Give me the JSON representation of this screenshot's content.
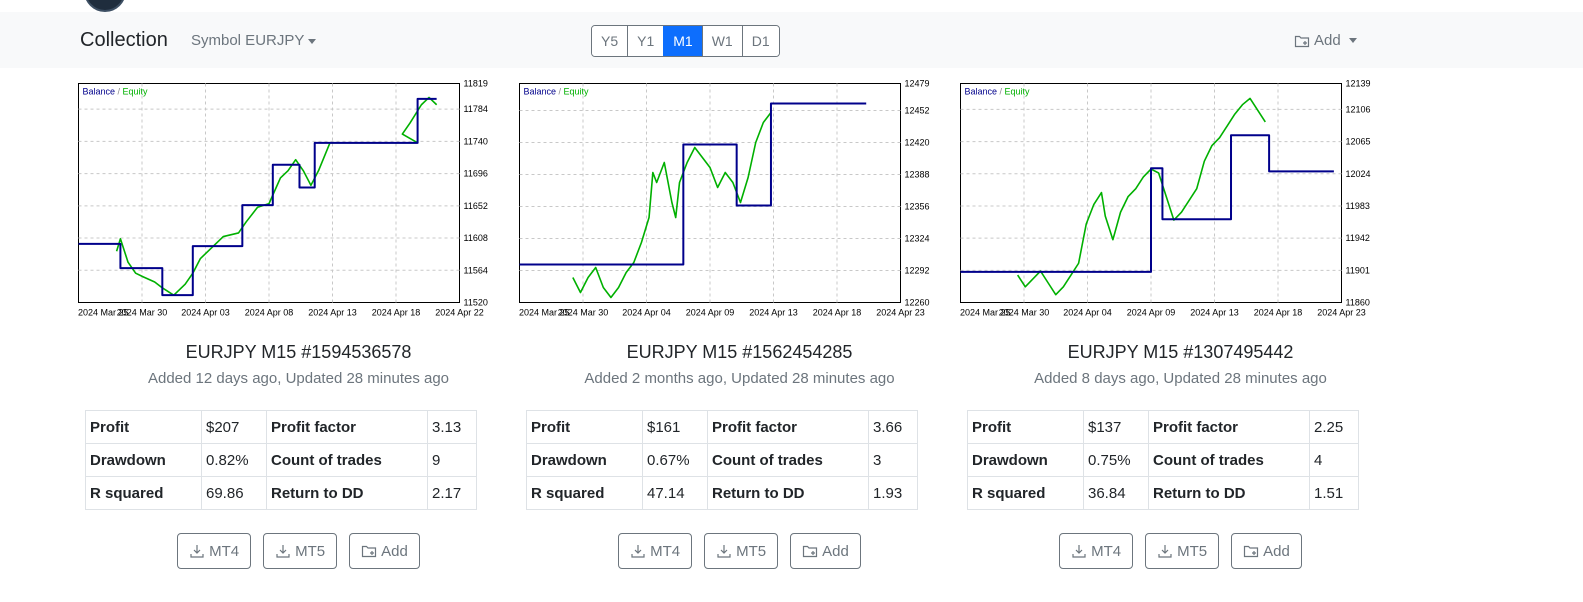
{
  "navbar": {
    "brand": "Collection",
    "symbol_label": "Symbol EURJPY",
    "timeframes": [
      "Y5",
      "Y1",
      "M1",
      "W1",
      "D1"
    ],
    "active_timeframe": "M1",
    "add_label": "Add"
  },
  "colors": {
    "balance": "#00008b",
    "equity": "#00b000",
    "accent": "#0d6efd",
    "muted": "#6c757d"
  },
  "stat_labels": {
    "profit": "Profit",
    "profit_factor": "Profit factor",
    "drawdown": "Drawdown",
    "count_of_trades": "Count of trades",
    "r_squared": "R squared",
    "return_to_dd": "Return to DD"
  },
  "button_labels": {
    "mt4": "MT4",
    "mt5": "MT5",
    "add": "Add"
  },
  "cards": [
    {
      "title": "EURJPY M15 #1594536578",
      "subtitle": "Added 12 days ago, Updated 28 minutes ago",
      "stats": {
        "profit": "$207",
        "profit_factor": "3.13",
        "drawdown": "0.82%",
        "count_of_trades": "9",
        "r_squared": "69.86",
        "return_to_dd": "2.17"
      },
      "chart_data": {
        "type": "line",
        "legend": [
          "Balance",
          "Equity"
        ],
        "x_ticks": [
          "2024 Mar 25",
          "2024 Mar 30",
          "2024 Apr 03",
          "2024 Apr 08",
          "2024 Apr 13",
          "2024 Apr 18",
          "2024 Apr 22"
        ],
        "y_ticks": [
          11520,
          11564,
          11608,
          11652,
          11696,
          11740,
          11784,
          11819
        ],
        "ylim": [
          11520,
          11819
        ],
        "grid": true,
        "balance": [
          [
            0,
            11600
          ],
          [
            0.11,
            11600
          ],
          [
            0.11,
            11567
          ],
          [
            0.22,
            11567
          ],
          [
            0.22,
            11530
          ],
          [
            0.3,
            11530
          ],
          [
            0.3,
            11597
          ],
          [
            0.43,
            11597
          ],
          [
            0.43,
            11653
          ],
          [
            0.51,
            11653
          ],
          [
            0.51,
            11708
          ],
          [
            0.58,
            11708
          ],
          [
            0.58,
            11677
          ],
          [
            0.62,
            11677
          ],
          [
            0.62,
            11738
          ],
          [
            0.89,
            11738
          ],
          [
            0.89,
            11798
          ],
          [
            0.94,
            11798
          ]
        ],
        "equity": [
          [
            0.1,
            11590
          ],
          [
            0.11,
            11607
          ],
          [
            0.13,
            11575
          ],
          [
            0.15,
            11560
          ],
          [
            0.17,
            11555
          ],
          [
            0.2,
            11548
          ],
          [
            0.22,
            11540
          ],
          [
            0.25,
            11530
          ],
          [
            0.28,
            11545
          ],
          [
            0.3,
            11560
          ],
          [
            0.32,
            11580
          ],
          [
            0.35,
            11595
          ],
          [
            0.38,
            11610
          ],
          [
            0.42,
            11615
          ],
          [
            0.44,
            11630
          ],
          [
            0.47,
            11650
          ],
          [
            0.5,
            11655
          ],
          [
            0.53,
            11690
          ],
          [
            0.55,
            11700
          ],
          [
            0.57,
            11715
          ],
          [
            0.59,
            11700
          ],
          [
            0.61,
            11680
          ],
          [
            0.63,
            11700
          ],
          [
            0.66,
            11738
          ],
          [
            0.89,
            11738
          ],
          [
            0.85,
            11750
          ],
          [
            0.87,
            11765
          ],
          [
            0.9,
            11790
          ],
          [
            0.92,
            11800
          ],
          [
            0.94,
            11790
          ]
        ]
      }
    },
    {
      "title": "EURJPY M15 #1562454285",
      "subtitle": "Added 2 months ago, Updated 28 minutes ago",
      "stats": {
        "profit": "$161",
        "profit_factor": "3.66",
        "drawdown": "0.67%",
        "count_of_trades": "3",
        "r_squared": "47.14",
        "return_to_dd": "1.93"
      },
      "chart_data": {
        "type": "line",
        "legend": [
          "Balance",
          "Equity"
        ],
        "x_ticks": [
          "2024 Mar 25",
          "2024 Mar 30",
          "2024 Apr 04",
          "2024 Apr 09",
          "2024 Apr 13",
          "2024 Apr 18",
          "2024 Apr 23"
        ],
        "y_ticks": [
          12260,
          12292,
          12324,
          12356,
          12388,
          12420,
          12452,
          12479
        ],
        "ylim": [
          12260,
          12479
        ],
        "grid": true,
        "balance": [
          [
            0,
            12298
          ],
          [
            0.43,
            12298
          ],
          [
            0.43,
            12418
          ],
          [
            0.57,
            12418
          ],
          [
            0.57,
            12357
          ],
          [
            0.66,
            12357
          ],
          [
            0.66,
            12459
          ],
          [
            0.91,
            12459
          ]
        ],
        "equity": [
          [
            0.14,
            12285
          ],
          [
            0.16,
            12270
          ],
          [
            0.18,
            12285
          ],
          [
            0.2,
            12295
          ],
          [
            0.22,
            12275
          ],
          [
            0.24,
            12265
          ],
          [
            0.26,
            12275
          ],
          [
            0.28,
            12290
          ],
          [
            0.3,
            12300
          ],
          [
            0.32,
            12320
          ],
          [
            0.34,
            12345
          ],
          [
            0.35,
            12390
          ],
          [
            0.36,
            12380
          ],
          [
            0.38,
            12400
          ],
          [
            0.4,
            12360
          ],
          [
            0.41,
            12345
          ],
          [
            0.42,
            12380
          ],
          [
            0.44,
            12400
          ],
          [
            0.46,
            12415
          ],
          [
            0.48,
            12405
          ],
          [
            0.5,
            12395
          ],
          [
            0.52,
            12375
          ],
          [
            0.54,
            12390
          ],
          [
            0.56,
            12380
          ],
          [
            0.58,
            12360
          ],
          [
            0.6,
            12385
          ],
          [
            0.62,
            12420
          ],
          [
            0.64,
            12440
          ],
          [
            0.66,
            12450
          ]
        ]
      }
    },
    {
      "title": "EURJPY M15 #1307495442",
      "subtitle": "Added 8 days ago, Updated 28 minutes ago",
      "stats": {
        "profit": "$137",
        "profit_factor": "2.25",
        "drawdown": "0.75%",
        "count_of_trades": "4",
        "r_squared": "36.84",
        "return_to_dd": "1.51"
      },
      "chart_data": {
        "type": "line",
        "legend": [
          "Balance",
          "Equity"
        ],
        "x_ticks": [
          "2024 Mar 25",
          "2024 Mar 30",
          "2024 Apr 04",
          "2024 Apr 09",
          "2024 Apr 13",
          "2024 Apr 18",
          "2024 Apr 23"
        ],
        "y_ticks": [
          11860,
          11901,
          11942,
          11983,
          12024,
          12065,
          12106,
          12139
        ],
        "ylim": [
          11860,
          12139
        ],
        "grid": true,
        "balance": [
          [
            0,
            11899
          ],
          [
            0.5,
            11899
          ],
          [
            0.5,
            12031
          ],
          [
            0.53,
            12031
          ],
          [
            0.53,
            11966
          ],
          [
            0.71,
            11966
          ],
          [
            0.71,
            12073
          ],
          [
            0.81,
            12073
          ],
          [
            0.81,
            12027
          ],
          [
            0.98,
            12027
          ]
        ],
        "equity": [
          [
            0.15,
            11895
          ],
          [
            0.17,
            11880
          ],
          [
            0.19,
            11890
          ],
          [
            0.21,
            11900
          ],
          [
            0.23,
            11885
          ],
          [
            0.25,
            11870
          ],
          [
            0.27,
            11880
          ],
          [
            0.29,
            11895
          ],
          [
            0.31,
            11910
          ],
          [
            0.33,
            11960
          ],
          [
            0.35,
            11985
          ],
          [
            0.37,
            12000
          ],
          [
            0.38,
            11970
          ],
          [
            0.4,
            11940
          ],
          [
            0.42,
            11975
          ],
          [
            0.44,
            11995
          ],
          [
            0.46,
            12005
          ],
          [
            0.48,
            12020
          ],
          [
            0.5,
            12030
          ],
          [
            0.52,
            12025
          ],
          [
            0.54,
            11995
          ],
          [
            0.56,
            11965
          ],
          [
            0.58,
            11975
          ],
          [
            0.6,
            11990
          ],
          [
            0.62,
            12005
          ],
          [
            0.64,
            12040
          ],
          [
            0.66,
            12060
          ],
          [
            0.68,
            12070
          ],
          [
            0.7,
            12085
          ],
          [
            0.72,
            12100
          ],
          [
            0.74,
            12112
          ],
          [
            0.76,
            12120
          ],
          [
            0.78,
            12105
          ],
          [
            0.8,
            12090
          ]
        ]
      }
    }
  ]
}
